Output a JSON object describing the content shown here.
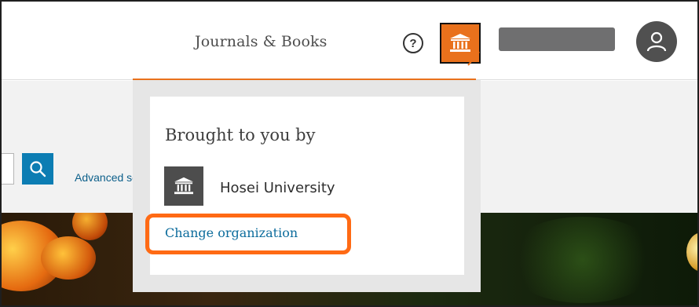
{
  "header": {
    "nav_journals_label": "Journals & Books",
    "help_label": "?",
    "institution_icon": "institution-icon",
    "user_icon": "user-icon"
  },
  "search": {
    "advanced_label": "Advanced sea",
    "button_icon": "search-icon"
  },
  "dropdown": {
    "heading": "Brought to you by",
    "organization_name": "Hosei University",
    "change_link": "Change organization"
  },
  "colors": {
    "accent": "#e9711c",
    "highlight": "#ff6a14",
    "link": "#0c6c9c",
    "search_button": "#0c7db3"
  }
}
